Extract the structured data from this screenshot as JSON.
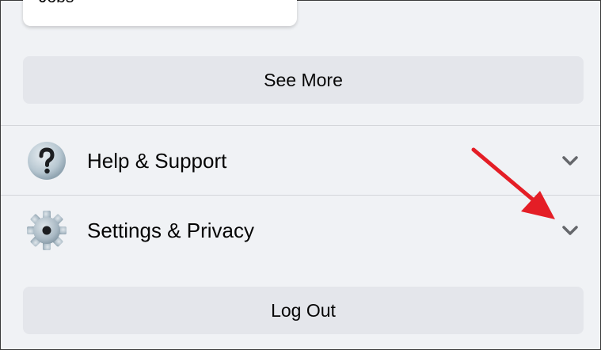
{
  "top_card": {
    "label": "Jobs"
  },
  "see_more": {
    "label": "See More"
  },
  "menu": [
    {
      "label": "Help & Support",
      "icon": "question-icon"
    },
    {
      "label": "Settings & Privacy",
      "icon": "gear-icon"
    }
  ],
  "logout": {
    "label": "Log Out"
  },
  "colors": {
    "background": "#f0f2f5",
    "button": "#e4e6eb",
    "annotation_arrow": "#e41e26",
    "chevron": "#65676b"
  }
}
